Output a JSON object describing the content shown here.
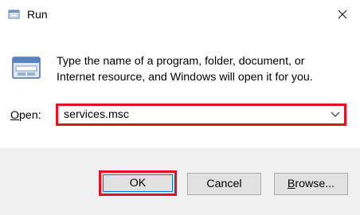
{
  "window": {
    "title": "Run",
    "close_glyph": "✕"
  },
  "icons": {
    "app": "run-icon",
    "dialog": "run-window-icon",
    "dropdown": "chevron-down-icon"
  },
  "description": {
    "line1": "Type the name of a program, folder, document, or",
    "line2": "Internet resource, and Windows will open it for you."
  },
  "open_field": {
    "label_accel": "O",
    "label_rest": "pen:",
    "value": "services.msc"
  },
  "buttons": {
    "ok": "OK",
    "cancel": "Cancel",
    "browse_accel": "B",
    "browse_rest": "rowse..."
  },
  "colors": {
    "highlight": "#e0141e",
    "footer_bg": "#f0f0f0"
  }
}
